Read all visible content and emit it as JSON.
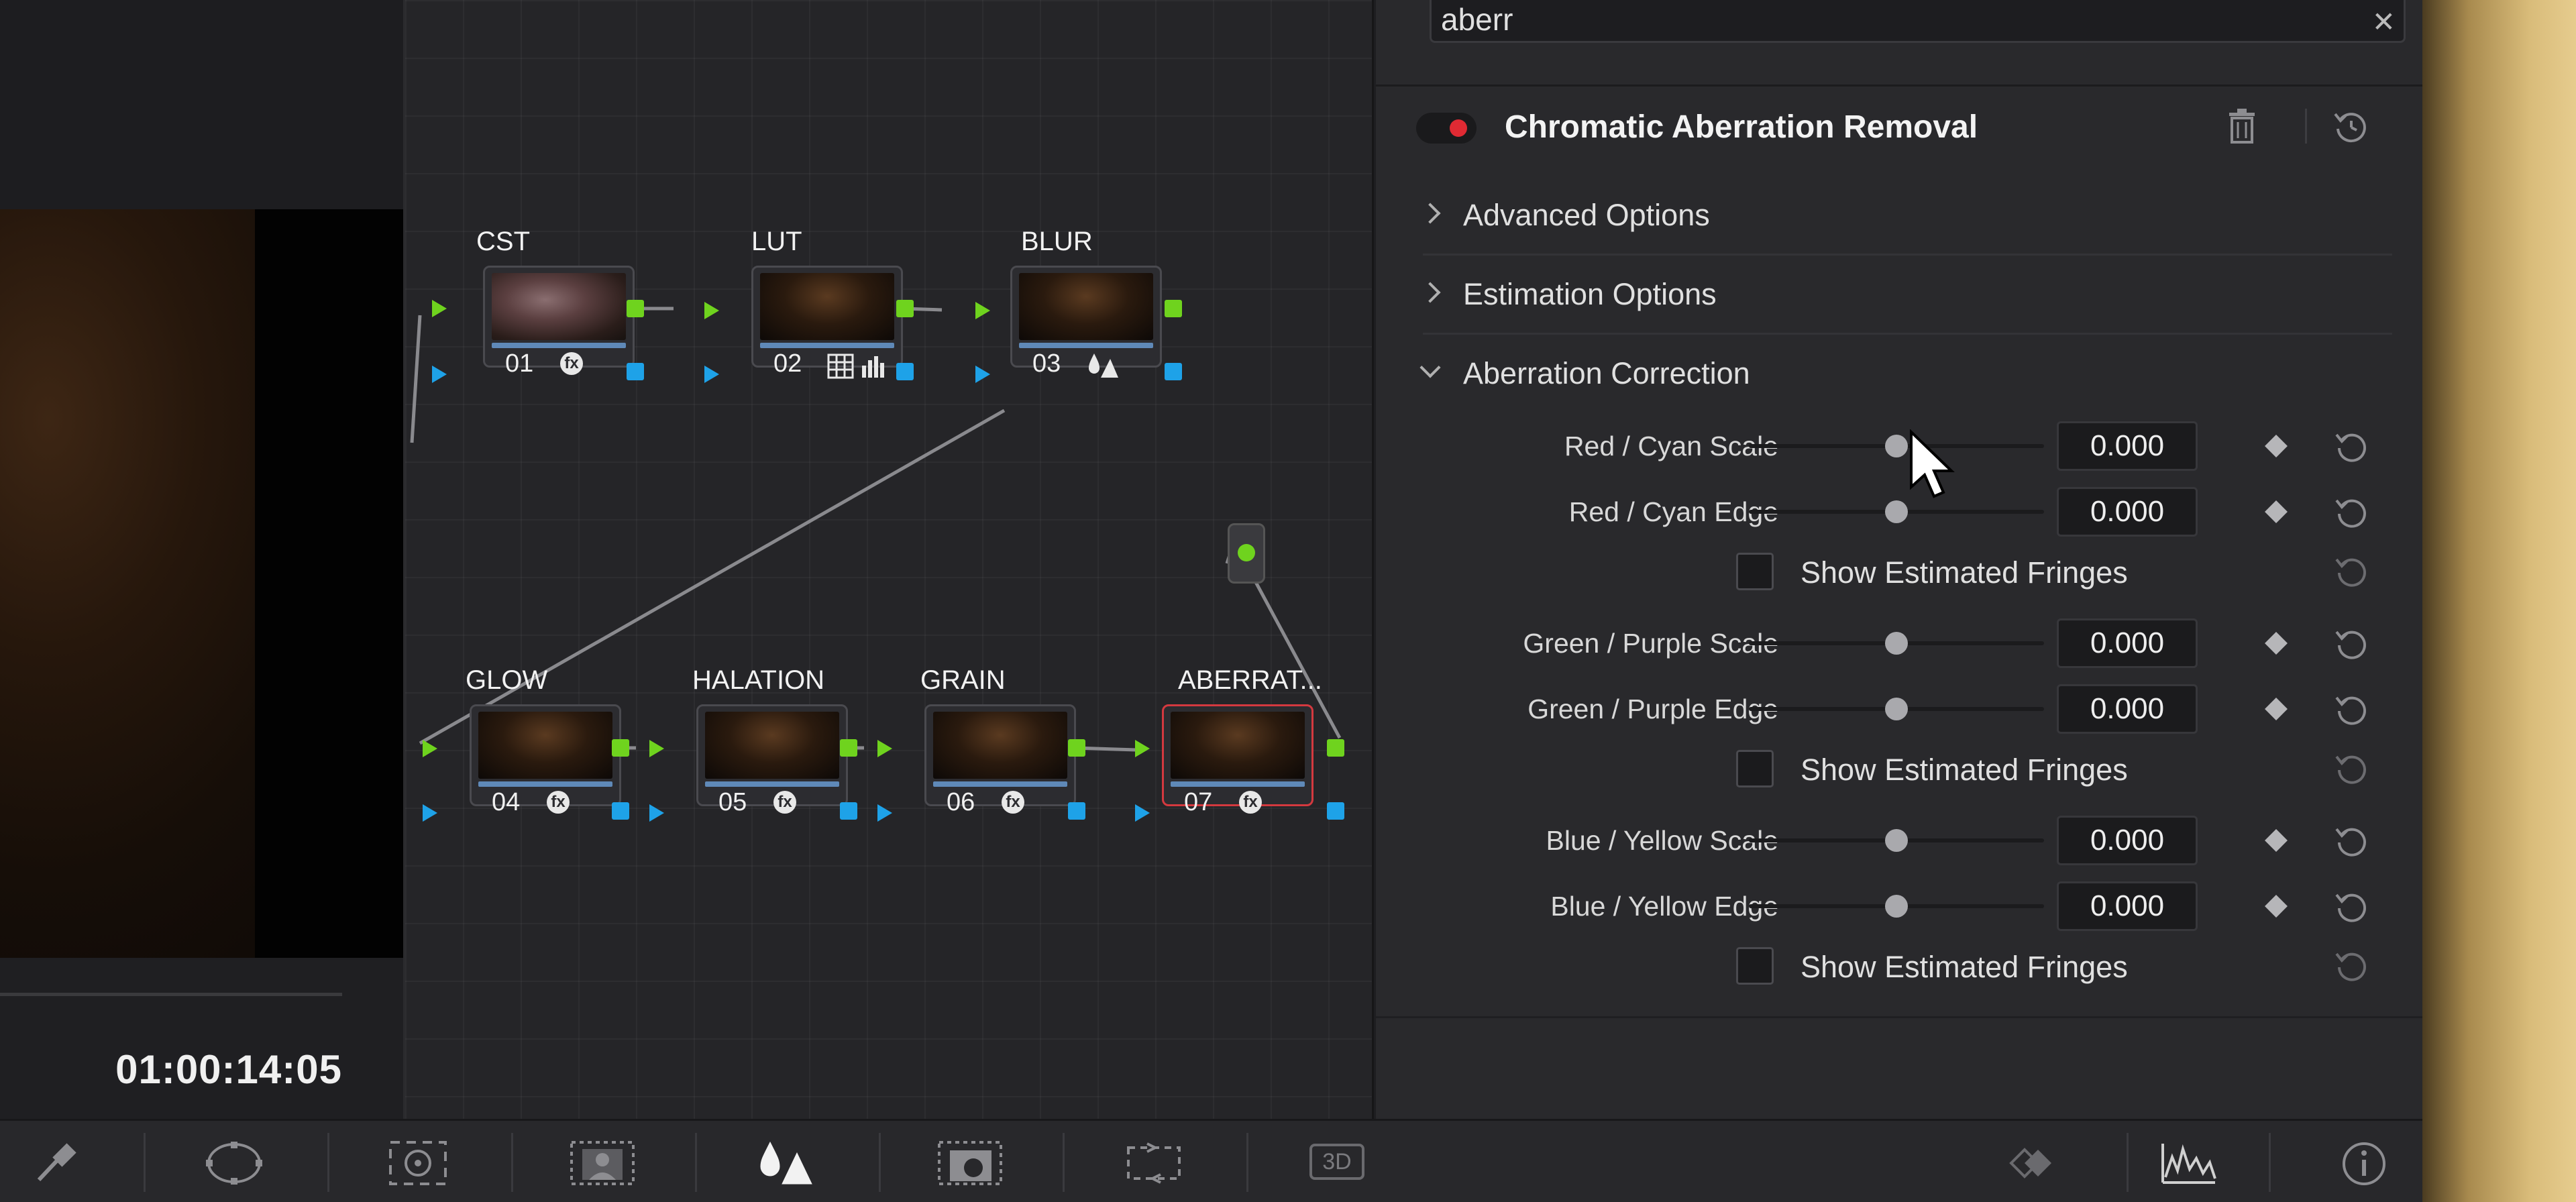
{
  "viewer": {
    "timecode": "01:00:14:05"
  },
  "node_graph": {
    "nodes": [
      {
        "label": "CST",
        "number": "01",
        "tool_icon": "fx-icon"
      },
      {
        "label": "LUT",
        "number": "02",
        "tool_icon": "lut-grid-icon"
      },
      {
        "label": "BLUR",
        "number": "03",
        "tool_icon": "blur-drops-icon"
      },
      {
        "label": "GLOW",
        "number": "04",
        "tool_icon": "fx-icon"
      },
      {
        "label": "HALATION",
        "number": "05",
        "tool_icon": "fx-icon"
      },
      {
        "label": "GRAIN",
        "number": "06",
        "tool_icon": "fx-icon"
      },
      {
        "label": "ABERRAT...",
        "number": "07",
        "tool_icon": "fx-icon",
        "selected": true
      }
    ],
    "fx_glyph": "fx"
  },
  "inspector": {
    "search": {
      "value": "aberr",
      "clear_glyph": "✕"
    },
    "effect": {
      "title": "Chromatic Aberration Removal",
      "enabled": true
    },
    "sections": [
      {
        "label": "Advanced Options",
        "expanded": false
      },
      {
        "label": "Estimation Options",
        "expanded": false
      },
      {
        "label": "Aberration Correction",
        "expanded": true
      }
    ],
    "params": [
      {
        "label": "Red / Cyan Scale",
        "value": "0.000",
        "slider_fraction": 0.5
      },
      {
        "label": "Red / Cyan Edge",
        "value": "0.000",
        "slider_fraction": 0.5
      },
      {
        "checkbox_label": "Show Estimated Fringes",
        "checked": false
      },
      {
        "label": "Green / Purple Scale",
        "value": "0.000",
        "slider_fraction": 0.5
      },
      {
        "label": "Green / Purple Edge",
        "value": "0.000",
        "slider_fraction": 0.5
      },
      {
        "checkbox_label": "Show Estimated Fringes",
        "checked": false
      },
      {
        "label": "Blue / Yellow Scale",
        "value": "0.000",
        "slider_fraction": 0.5
      },
      {
        "label": "Blue / Yellow Edge",
        "value": "0.000",
        "slider_fraction": 0.5
      },
      {
        "checkbox_label": "Show Estimated Fringes",
        "checked": false
      }
    ]
  },
  "toolbar": {
    "items": [
      {
        "icon": "eyedropper-icon"
      },
      {
        "icon": "power-window-icon"
      },
      {
        "icon": "tracker-icon"
      },
      {
        "icon": "magic-mask-icon"
      },
      {
        "icon": "blur-icon",
        "active": true
      },
      {
        "icon": "key-icon"
      },
      {
        "icon": "sizing-icon"
      },
      {
        "icon": "3d-icon",
        "text": "3D"
      },
      {
        "icon": "keyframes-icon"
      },
      {
        "icon": "scopes-icon"
      },
      {
        "icon": "info-icon"
      }
    ]
  },
  "colors": {
    "accent_red": "#e02a33",
    "node_green": "#6fd31e",
    "node_blue": "#1ea2e8",
    "selected_node_border": "#d4393f"
  }
}
